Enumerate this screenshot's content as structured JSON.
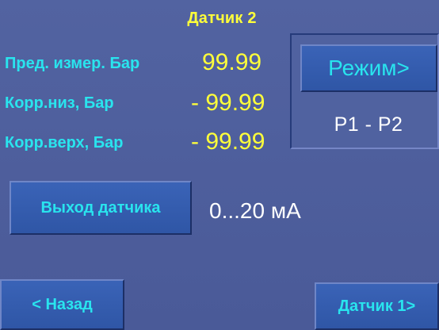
{
  "screen": {
    "title": "Датчик 2"
  },
  "measurement": {
    "range_label": "Пред. измер. Бар",
    "range_value": "99.99",
    "corr_low_label": "Корр.низ,  Бар",
    "corr_low_value": "- 99.99",
    "corr_high_label": "Корр.верх, Бар",
    "corr_high_value": "- 99.99"
  },
  "mode": {
    "button_label": "Режим>",
    "current_value": "P1 - P2"
  },
  "output": {
    "button_label": "Выход датчика",
    "value": "0...20 мА"
  },
  "navigation": {
    "back_label": "< Назад",
    "next_label": "Датчик 1>"
  },
  "colors": {
    "background": "#4d5d9b",
    "title_yellow": "#ffff3a",
    "label_cyan": "#29e4ee",
    "button_blue": "#3a63b7",
    "text_white": "#ffffff"
  }
}
